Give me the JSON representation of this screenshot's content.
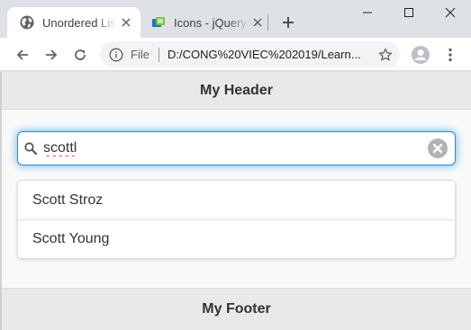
{
  "browser": {
    "tabs": [
      {
        "title": "Unordered List",
        "favicon": "chrome-globe-icon",
        "active": true
      },
      {
        "title": "Icons - jQuery Mobile",
        "favicon": "jquery-favicon-icon",
        "active": false
      }
    ],
    "toolbar": {
      "scheme_label": "File",
      "url": "D:/CONG%20VIEC%202019/Learn..."
    }
  },
  "page": {
    "header_title": "My Header",
    "search": {
      "value": "scottl",
      "placeholder": ""
    },
    "results": [
      {
        "label": "Scott Stroz"
      },
      {
        "label": "Scott Young"
      }
    ],
    "footer_title": "My Footer"
  },
  "colors": {
    "focus_ring": "#59b3f0",
    "bar_background": "#e9e9e9",
    "page_background": "#f9f9f9",
    "chrome_frame": "#dee1e6"
  }
}
